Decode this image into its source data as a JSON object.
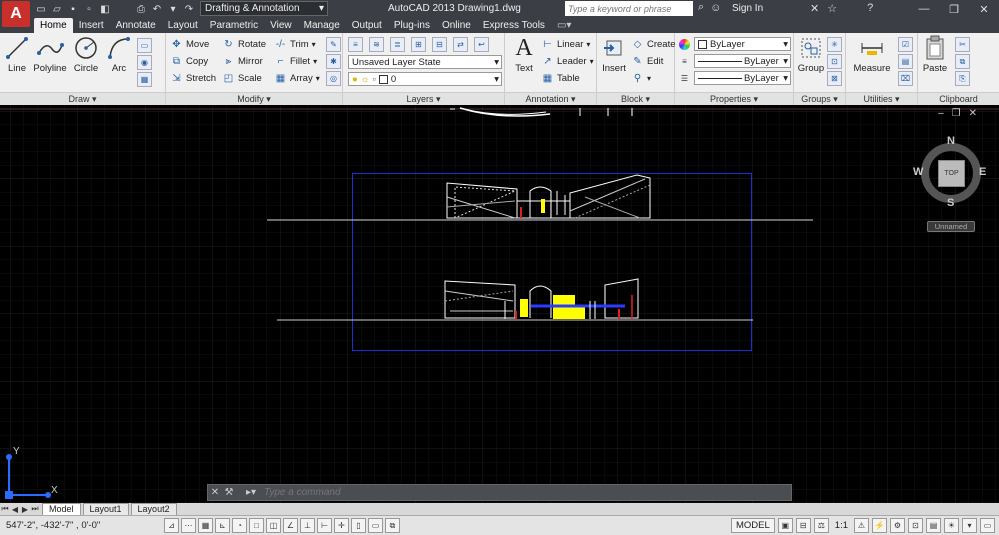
{
  "app": {
    "logo": "A",
    "workspace": "Drafting & Annotation",
    "title": "AutoCAD 2013    Drawing1.dwg",
    "search_placeholder": "Type a keyword or phrase",
    "sign_in": "Sign In"
  },
  "tabs": [
    {
      "label": "Home",
      "active": true
    },
    {
      "label": "Insert"
    },
    {
      "label": "Annotate"
    },
    {
      "label": "Layout"
    },
    {
      "label": "Parametric"
    },
    {
      "label": "View"
    },
    {
      "label": "Manage"
    },
    {
      "label": "Output"
    },
    {
      "label": "Plug-ins"
    },
    {
      "label": "Online"
    },
    {
      "label": "Express Tools"
    }
  ],
  "panels": {
    "draw": {
      "title": "Draw ▾",
      "line": "Line",
      "polyline": "Polyline",
      "circle": "Circle",
      "arc": "Arc"
    },
    "modify": {
      "title": "Modify ▾",
      "move": "Move",
      "rotate": "Rotate",
      "trim": "Trim",
      "copy": "Copy",
      "mirror": "Mirror",
      "fillet": "Fillet",
      "stretch": "Stretch",
      "scale": "Scale",
      "array": "Array"
    },
    "layers": {
      "title": "Layers ▾",
      "layer_state": "Unsaved Layer State",
      "current_layer": "0"
    },
    "annotation": {
      "title": "Annotation ▾",
      "text": "Text",
      "linear": "Linear",
      "leader": "Leader",
      "table": "Table"
    },
    "block": {
      "title": "Block ▾",
      "insert": "Insert",
      "create": "Create",
      "edit": "Edit"
    },
    "properties": {
      "title": "Properties ▾",
      "color": "ByLayer",
      "linetype": "ByLayer",
      "lineweight": "ByLayer"
    },
    "groups": {
      "title": "Groups ▾",
      "group": "Group"
    },
    "utilities": {
      "title": "Utilities ▾",
      "measure": "Measure"
    },
    "clipboard": {
      "title": "Clipboard",
      "paste": "Paste"
    }
  },
  "viewcube": {
    "north": "N",
    "south": "S",
    "east": "E",
    "west": "W",
    "face": "TOP",
    "ucs": "Unnamed"
  },
  "ucs_axes": {
    "x": "X",
    "y": "Y"
  },
  "command": {
    "placeholder": "Type a command"
  },
  "layout_tabs": [
    {
      "label": "Model",
      "active": true
    },
    {
      "label": "Layout1"
    },
    {
      "label": "Layout2"
    }
  ],
  "status": {
    "coords": "547'-2\",  -432'-7\"  , 0'-0\"",
    "space": "MODEL",
    "annotation_scale": "1:1"
  },
  "colors": {
    "ribbon_bg": "#f0f0f0",
    "titlebar_bg": "#3b3f45",
    "canvas_bg": "#000000",
    "extents_frame": "#1a2fd6",
    "highlight_yellow": "#ffff00",
    "accent_red": "#e02020"
  }
}
